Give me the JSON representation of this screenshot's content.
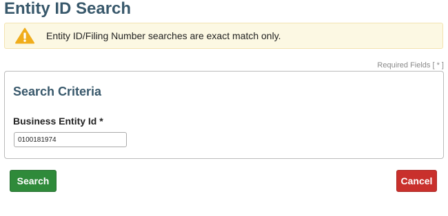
{
  "page": {
    "title": "Entity ID Search"
  },
  "alert": {
    "icon": "warning-icon",
    "message": "Entity ID/Filing Number searches are exact match only.",
    "background_color": "#fcf8e3",
    "icon_color": "#f0ad1c"
  },
  "required_note": "Required Fields [ * ]",
  "criteria": {
    "heading": "Search Criteria",
    "field_label": "Business Entity Id *",
    "field_value": "0100181974"
  },
  "actions": {
    "search_label": "Search",
    "cancel_label": "Cancel",
    "search_color": "#2f8a3a",
    "cancel_color": "#c9302c"
  }
}
